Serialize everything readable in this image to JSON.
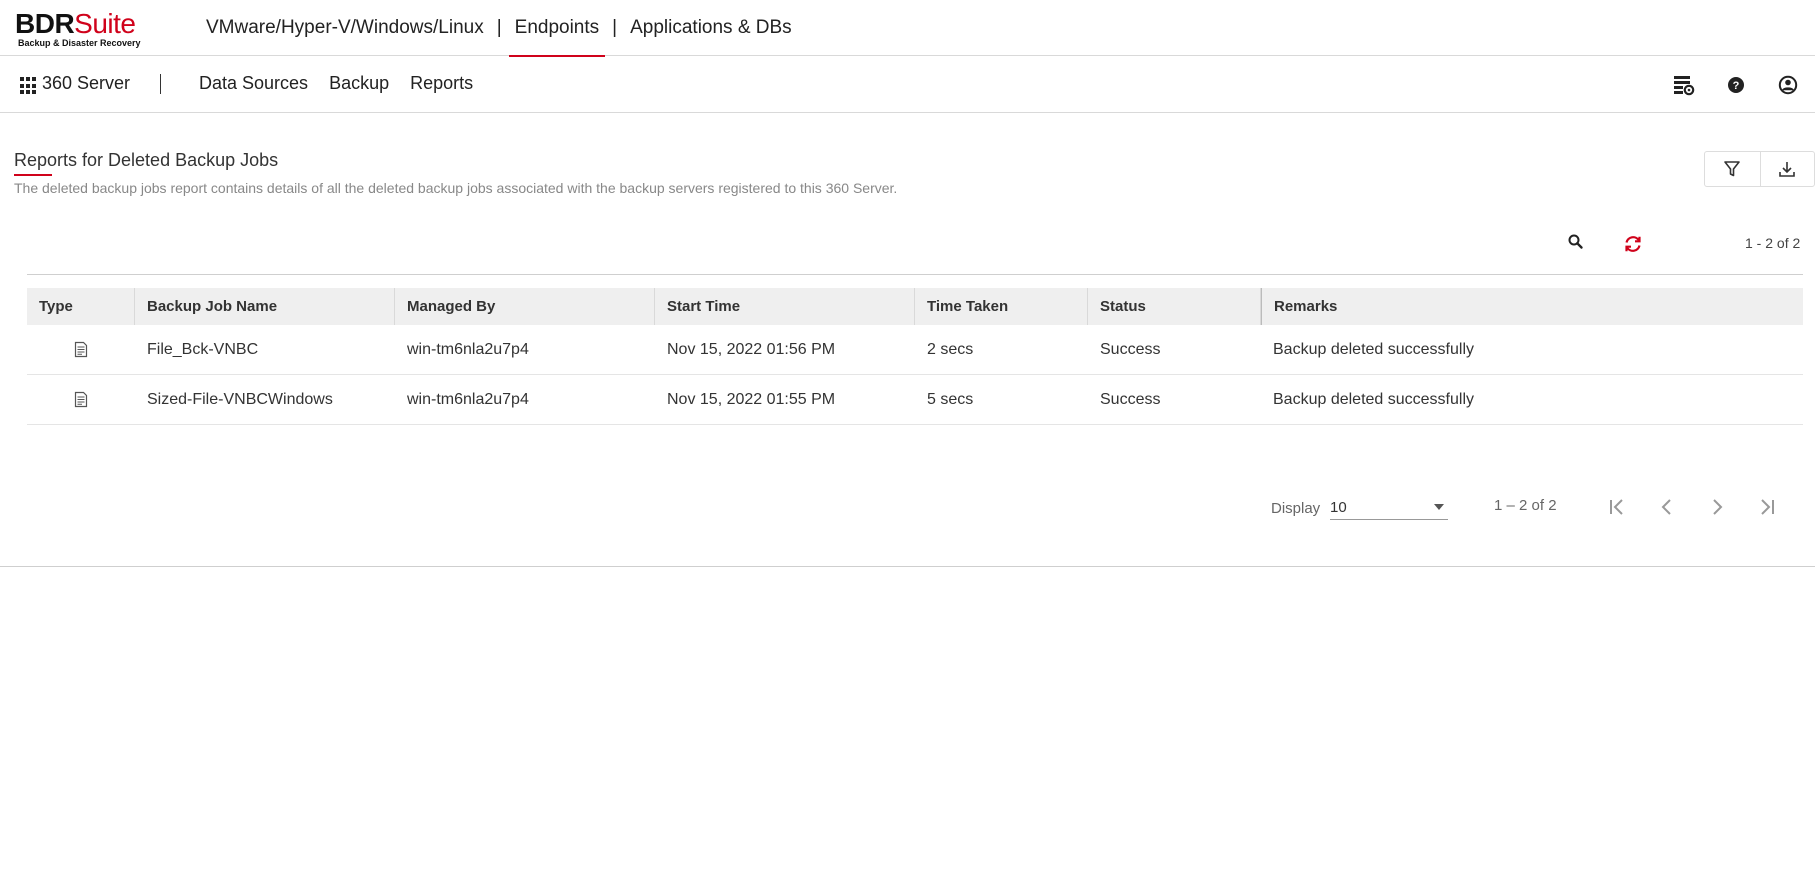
{
  "brand": {
    "name_part1": "BDR",
    "name_part2": "Suite",
    "tagline": "Backup & Disaster Recovery",
    "accent_color": "#d0021b"
  },
  "top_nav": {
    "items": [
      {
        "label": "VMware/Hyper-V/Windows/Linux",
        "active": false
      },
      {
        "label": "Endpoints",
        "active": true
      },
      {
        "label": "Applications & DBs",
        "active": false
      }
    ],
    "separator": "|"
  },
  "sub_nav": {
    "server_label": "360 Server",
    "items": [
      "Data Sources",
      "Backup",
      "Reports"
    ],
    "icons": [
      "settings-list-icon",
      "help-icon",
      "user-account-icon"
    ]
  },
  "report": {
    "title": "Reports for Deleted Backup Jobs",
    "description": "The deleted backup jobs report contains details of all the deleted backup jobs associated with the backup servers registered to this 360 Server.",
    "tools": [
      "filter-icon",
      "download-icon"
    ],
    "count_text": "1 - 2 of 2"
  },
  "table": {
    "columns": [
      "Type",
      "Backup Job Name",
      "Managed By",
      "Start Time",
      "Time Taken",
      "Status",
      "Remarks"
    ],
    "rows": [
      {
        "type_icon": "file-backup-icon",
        "name": "File_Bck-VNBC",
        "managed_by": "win-tm6nla2u7p4",
        "start_time": "Nov 15, 2022 01:56 PM",
        "time_taken": "2 secs",
        "status": "Success",
        "remarks": "Backup deleted successfully"
      },
      {
        "type_icon": "file-backup-icon",
        "name": "Sized-File-VNBCWindows",
        "managed_by": "win-tm6nla2u7p4",
        "start_time": "Nov 15, 2022 01:55 PM",
        "time_taken": "5 secs",
        "status": "Success",
        "remarks": "Backup deleted successfully"
      }
    ]
  },
  "pagination": {
    "display_label": "Display",
    "page_size": "10",
    "range_text": "1 – 2 of 2"
  }
}
